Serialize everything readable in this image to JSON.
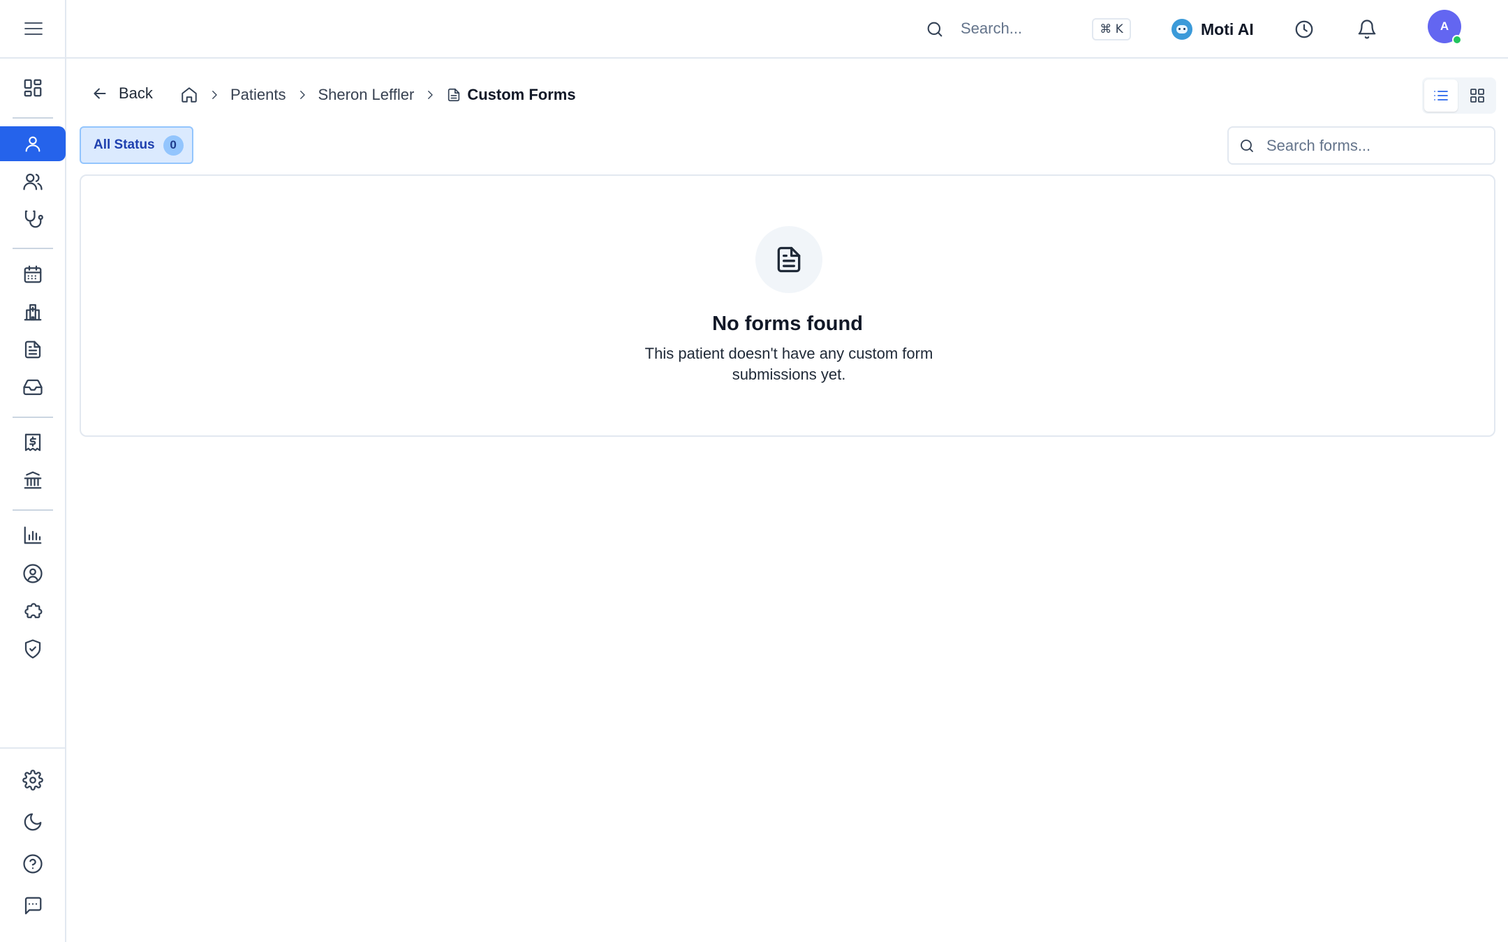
{
  "topbar": {
    "search_placeholder": "Search...",
    "shortcut": "⌘ K",
    "ai_assistant_label": "Moti AI",
    "avatar_initial": "A"
  },
  "sidebar": {
    "active_item": "patients",
    "items": [
      {
        "name": "dashboard",
        "icon": "grid-icon"
      },
      {
        "name": "patients",
        "icon": "user-icon",
        "active": true
      },
      {
        "name": "users",
        "icon": "users-icon"
      },
      {
        "name": "clinical",
        "icon": "stethoscope-icon"
      },
      {
        "name": "calendar",
        "icon": "calendar-icon"
      },
      {
        "name": "facilities",
        "icon": "hospital-icon"
      },
      {
        "name": "documents",
        "icon": "document-icon"
      },
      {
        "name": "inbox",
        "icon": "inbox-icon"
      },
      {
        "name": "billing",
        "icon": "receipt-dollar-icon"
      },
      {
        "name": "insurance",
        "icon": "bank-icon"
      },
      {
        "name": "reports",
        "icon": "bar-chart-icon"
      },
      {
        "name": "account",
        "icon": "user-circle-icon"
      },
      {
        "name": "integrations",
        "icon": "puzzle-icon"
      },
      {
        "name": "security",
        "icon": "shield-check-icon"
      }
    ],
    "bottom_items": [
      {
        "name": "settings",
        "icon": "gear-icon"
      },
      {
        "name": "theme",
        "icon": "moon-icon"
      },
      {
        "name": "help",
        "icon": "help-circle-icon"
      },
      {
        "name": "feedback",
        "icon": "message-icon"
      }
    ]
  },
  "breadcrumb": {
    "back_label": "Back",
    "items": [
      "Patients",
      "Sheron Leffler"
    ],
    "current": "Custom Forms"
  },
  "view_toggle": {
    "active": "list"
  },
  "filter": {
    "status_label": "All Status",
    "status_count": "0"
  },
  "forms_search": {
    "placeholder": "Search forms..."
  },
  "empty_state": {
    "title": "No forms found",
    "description": "This patient doesn't have any custom form submissions yet."
  },
  "colors": {
    "primary": "#2563eb",
    "chip_bg": "#dbeafe",
    "avatar": "#6366f1",
    "online": "#22c55e"
  }
}
